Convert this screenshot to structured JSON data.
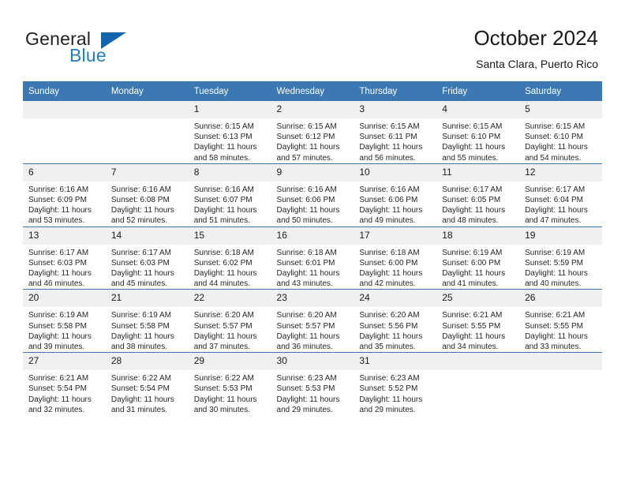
{
  "brand": {
    "name_part1": "General",
    "name_part2": "Blue",
    "triangle_color": "#1366ab",
    "blue_color": "#1f7fc4"
  },
  "header": {
    "month_title": "October 2024",
    "location": "Santa Clara, Puerto Rico"
  },
  "theme": {
    "header_bar_color": "#3c78b4",
    "daynum_band_color": "#f0f0f0",
    "grid_line_color": "#3c78b4",
    "text_color": "#1a1a1a"
  },
  "weekday_headers": [
    "Sunday",
    "Monday",
    "Tuesday",
    "Wednesday",
    "Thursday",
    "Friday",
    "Saturday"
  ],
  "labels": {
    "sunrise_prefix": "Sunrise:",
    "sunset_prefix": "Sunset:",
    "daylight_prefix": "Daylight:"
  },
  "weeks": [
    [
      {
        "day": "",
        "empty": true,
        "sunrise": "",
        "sunset": "",
        "daylight": ""
      },
      {
        "day": "",
        "empty": true,
        "sunrise": "",
        "sunset": "",
        "daylight": ""
      },
      {
        "day": "1",
        "sunrise": "Sunrise: 6:15 AM",
        "sunset": "Sunset: 6:13 PM",
        "daylight": "Daylight: 11 hours and 58 minutes."
      },
      {
        "day": "2",
        "sunrise": "Sunrise: 6:15 AM",
        "sunset": "Sunset: 6:12 PM",
        "daylight": "Daylight: 11 hours and 57 minutes."
      },
      {
        "day": "3",
        "sunrise": "Sunrise: 6:15 AM",
        "sunset": "Sunset: 6:11 PM",
        "daylight": "Daylight: 11 hours and 56 minutes."
      },
      {
        "day": "4",
        "sunrise": "Sunrise: 6:15 AM",
        "sunset": "Sunset: 6:10 PM",
        "daylight": "Daylight: 11 hours and 55 minutes."
      },
      {
        "day": "5",
        "sunrise": "Sunrise: 6:15 AM",
        "sunset": "Sunset: 6:10 PM",
        "daylight": "Daylight: 11 hours and 54 minutes."
      }
    ],
    [
      {
        "day": "6",
        "sunrise": "Sunrise: 6:16 AM",
        "sunset": "Sunset: 6:09 PM",
        "daylight": "Daylight: 11 hours and 53 minutes."
      },
      {
        "day": "7",
        "sunrise": "Sunrise: 6:16 AM",
        "sunset": "Sunset: 6:08 PM",
        "daylight": "Daylight: 11 hours and 52 minutes."
      },
      {
        "day": "8",
        "sunrise": "Sunrise: 6:16 AM",
        "sunset": "Sunset: 6:07 PM",
        "daylight": "Daylight: 11 hours and 51 minutes."
      },
      {
        "day": "9",
        "sunrise": "Sunrise: 6:16 AM",
        "sunset": "Sunset: 6:06 PM",
        "daylight": "Daylight: 11 hours and 50 minutes."
      },
      {
        "day": "10",
        "sunrise": "Sunrise: 6:16 AM",
        "sunset": "Sunset: 6:06 PM",
        "daylight": "Daylight: 11 hours and 49 minutes."
      },
      {
        "day": "11",
        "sunrise": "Sunrise: 6:17 AM",
        "sunset": "Sunset: 6:05 PM",
        "daylight": "Daylight: 11 hours and 48 minutes."
      },
      {
        "day": "12",
        "sunrise": "Sunrise: 6:17 AM",
        "sunset": "Sunset: 6:04 PM",
        "daylight": "Daylight: 11 hours and 47 minutes."
      }
    ],
    [
      {
        "day": "13",
        "sunrise": "Sunrise: 6:17 AM",
        "sunset": "Sunset: 6:03 PM",
        "daylight": "Daylight: 11 hours and 46 minutes."
      },
      {
        "day": "14",
        "sunrise": "Sunrise: 6:17 AM",
        "sunset": "Sunset: 6:03 PM",
        "daylight": "Daylight: 11 hours and 45 minutes."
      },
      {
        "day": "15",
        "sunrise": "Sunrise: 6:18 AM",
        "sunset": "Sunset: 6:02 PM",
        "daylight": "Daylight: 11 hours and 44 minutes."
      },
      {
        "day": "16",
        "sunrise": "Sunrise: 6:18 AM",
        "sunset": "Sunset: 6:01 PM",
        "daylight": "Daylight: 11 hours and 43 minutes."
      },
      {
        "day": "17",
        "sunrise": "Sunrise: 6:18 AM",
        "sunset": "Sunset: 6:00 PM",
        "daylight": "Daylight: 11 hours and 42 minutes."
      },
      {
        "day": "18",
        "sunrise": "Sunrise: 6:19 AM",
        "sunset": "Sunset: 6:00 PM",
        "daylight": "Daylight: 11 hours and 41 minutes."
      },
      {
        "day": "19",
        "sunrise": "Sunrise: 6:19 AM",
        "sunset": "Sunset: 5:59 PM",
        "daylight": "Daylight: 11 hours and 40 minutes."
      }
    ],
    [
      {
        "day": "20",
        "sunrise": "Sunrise: 6:19 AM",
        "sunset": "Sunset: 5:58 PM",
        "daylight": "Daylight: 11 hours and 39 minutes."
      },
      {
        "day": "21",
        "sunrise": "Sunrise: 6:19 AM",
        "sunset": "Sunset: 5:58 PM",
        "daylight": "Daylight: 11 hours and 38 minutes."
      },
      {
        "day": "22",
        "sunrise": "Sunrise: 6:20 AM",
        "sunset": "Sunset: 5:57 PM",
        "daylight": "Daylight: 11 hours and 37 minutes."
      },
      {
        "day": "23",
        "sunrise": "Sunrise: 6:20 AM",
        "sunset": "Sunset: 5:57 PM",
        "daylight": "Daylight: 11 hours and 36 minutes."
      },
      {
        "day": "24",
        "sunrise": "Sunrise: 6:20 AM",
        "sunset": "Sunset: 5:56 PM",
        "daylight": "Daylight: 11 hours and 35 minutes."
      },
      {
        "day": "25",
        "sunrise": "Sunrise: 6:21 AM",
        "sunset": "Sunset: 5:55 PM",
        "daylight": "Daylight: 11 hours and 34 minutes."
      },
      {
        "day": "26",
        "sunrise": "Sunrise: 6:21 AM",
        "sunset": "Sunset: 5:55 PM",
        "daylight": "Daylight: 11 hours and 33 minutes."
      }
    ],
    [
      {
        "day": "27",
        "sunrise": "Sunrise: 6:21 AM",
        "sunset": "Sunset: 5:54 PM",
        "daylight": "Daylight: 11 hours and 32 minutes."
      },
      {
        "day": "28",
        "sunrise": "Sunrise: 6:22 AM",
        "sunset": "Sunset: 5:54 PM",
        "daylight": "Daylight: 11 hours and 31 minutes."
      },
      {
        "day": "29",
        "sunrise": "Sunrise: 6:22 AM",
        "sunset": "Sunset: 5:53 PM",
        "daylight": "Daylight: 11 hours and 30 minutes."
      },
      {
        "day": "30",
        "sunrise": "Sunrise: 6:23 AM",
        "sunset": "Sunset: 5:53 PM",
        "daylight": "Daylight: 11 hours and 29 minutes."
      },
      {
        "day": "31",
        "sunrise": "Sunrise: 6:23 AM",
        "sunset": "Sunset: 5:52 PM",
        "daylight": "Daylight: 11 hours and 29 minutes."
      },
      {
        "day": "",
        "empty": true,
        "sunrise": "",
        "sunset": "",
        "daylight": ""
      },
      {
        "day": "",
        "empty": true,
        "sunrise": "",
        "sunset": "",
        "daylight": ""
      }
    ]
  ]
}
